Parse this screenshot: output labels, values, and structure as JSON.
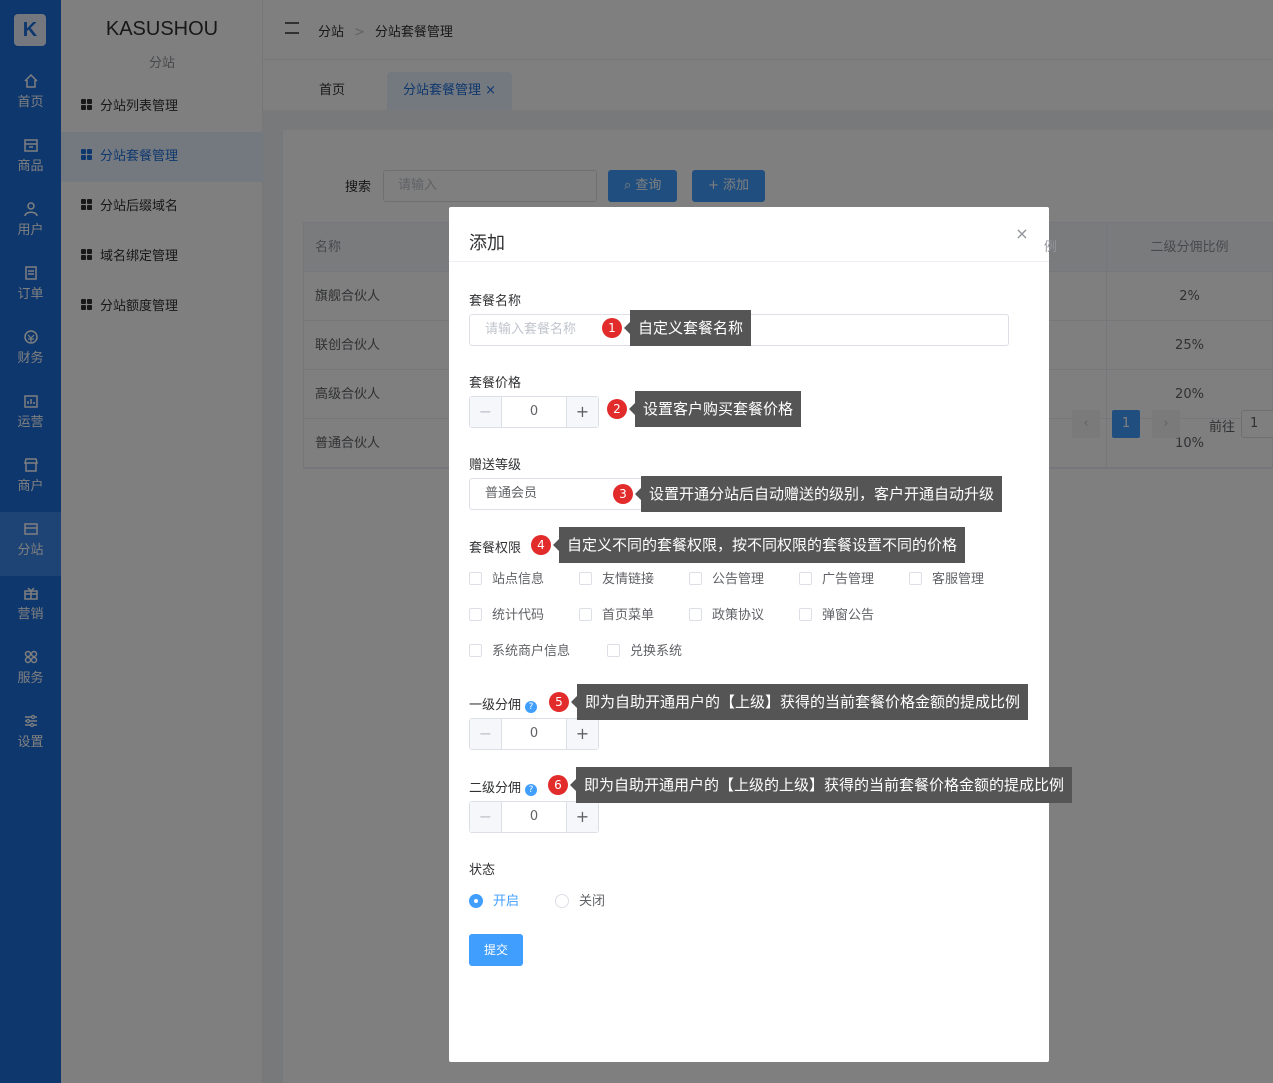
{
  "rail": {
    "logo": "K",
    "items": [
      {
        "label": "首页",
        "icon": "home-icon"
      },
      {
        "label": "商品",
        "icon": "box-icon"
      },
      {
        "label": "用户",
        "icon": "user-icon"
      },
      {
        "label": "订单",
        "icon": "order-icon"
      },
      {
        "label": "财务",
        "icon": "finance-icon"
      },
      {
        "label": "运营",
        "icon": "operation-icon"
      },
      {
        "label": "商户",
        "icon": "shop-icon"
      },
      {
        "label": "分站",
        "icon": "substation-icon"
      },
      {
        "label": "营销",
        "icon": "gift-icon"
      },
      {
        "label": "服务",
        "icon": "service-icon"
      },
      {
        "label": "设置",
        "icon": "settings-icon"
      }
    ]
  },
  "sidebar": {
    "brand": "KASUSHOU",
    "subtitle": "分站",
    "items": [
      {
        "label": "分站列表管理"
      },
      {
        "label": "分站套餐管理"
      },
      {
        "label": "分站后缀域名"
      },
      {
        "label": "域名绑定管理"
      },
      {
        "label": "分站额度管理"
      }
    ]
  },
  "breadcrumb": {
    "first": "分站",
    "separator": ">",
    "second": "分站套餐管理"
  },
  "tabs": {
    "home": "首页",
    "current": "分站套餐管理",
    "close": "×"
  },
  "search": {
    "label": "搜索",
    "placeholder": "请输入",
    "query_button": "查询",
    "add_button": "添加"
  },
  "table": {
    "columns": [
      "名称",
      "二级分佣比例"
    ],
    "rows": [
      {
        "name": "旗舰合伙人",
        "ratio": "2%"
      },
      {
        "name": "联创合伙人",
        "ratio": "25%"
      },
      {
        "name": "高级合伙人",
        "ratio": "20%"
      },
      {
        "name": "普通合伙人",
        "ratio": "10%"
      }
    ],
    "column_fragment": "例"
  },
  "pagination": {
    "prev": "‹",
    "current": "1",
    "next": "›",
    "goto_label": "前往",
    "goto_value": "1"
  },
  "dialog": {
    "title": "添加",
    "close": "×",
    "name_label": "套餐名称",
    "name_placeholder": "请输入套餐名称",
    "price_label": "套餐价格",
    "price_value": "0",
    "level_label": "赠送等级",
    "level_value": "普通会员",
    "permission_label": "套餐权限",
    "permissions": [
      "站点信息",
      "友情链接",
      "公告管理",
      "广告管理",
      "客服管理",
      "统计代码",
      "首页菜单",
      "政策协议",
      "弹窗公告",
      "系统商户信息",
      "兑换系统"
    ],
    "commission1_label": "一级分佣",
    "commission1_value": "0",
    "commission2_label": "二级分佣",
    "commission2_value": "0",
    "help": "?",
    "status_label": "状态",
    "status_on": "开启",
    "status_off": "关闭",
    "submit": "提交"
  },
  "annotations": [
    {
      "num": "1",
      "text": "自定义套餐名称"
    },
    {
      "num": "2",
      "text": "设置客户购买套餐价格"
    },
    {
      "num": "3",
      "text": "设置开通分站后自动赠送的级别，客户开通自动升级"
    },
    {
      "num": "4",
      "text": "自定义不同的套餐权限，按不同权限的套餐设置不同的价格"
    },
    {
      "num": "5",
      "text": "即为自助开通用户的【上级】获得的当前套餐价格金额的提成比例"
    },
    {
      "num": "6",
      "text": "即为自助开通用户的【上级的上级】获得的当前套餐价格金额的提成比例"
    }
  ],
  "colors": {
    "primary": "#409eff",
    "rail": "#1d6fdc",
    "annotation_badge": "#e22b2b",
    "tooltip": "#555555"
  }
}
